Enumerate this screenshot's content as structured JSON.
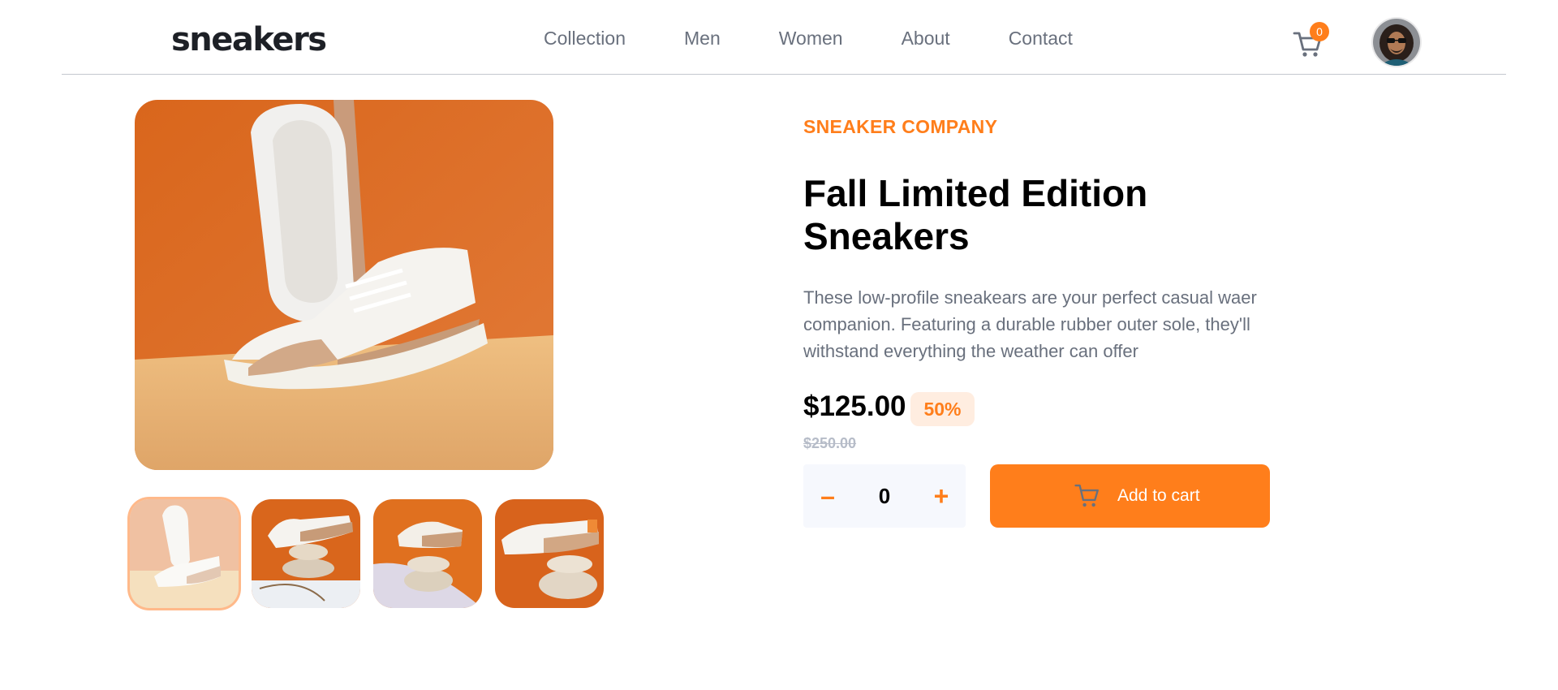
{
  "header": {
    "logo": "sneakers",
    "nav": [
      "Collection",
      "Men",
      "Women",
      "About",
      "Contact"
    ],
    "cart_count": "0",
    "cart_icon": "cart-icon",
    "avatar_icon": "user-avatar"
  },
  "product": {
    "company": "SNEAKER COMPANY",
    "title": "Fall Limited Edition Sneakers",
    "description": "These low-profile sneakears are your perfect casual waer companion. Featuring a durable rubber outer sole, they'll withstand everything the weather can offer",
    "price": "$125.00",
    "discount": "50%",
    "old_price": "$250.00",
    "quantity": "0",
    "minus_label": "–",
    "plus_label": "+",
    "add_to_cart": "Add to cart",
    "selected_thumbnail": 1
  },
  "colors": {
    "accent": "#ff7e1b",
    "accent_light": "#ffede0",
    "text_dark": "#1d2026",
    "text_gray": "#69707d"
  }
}
